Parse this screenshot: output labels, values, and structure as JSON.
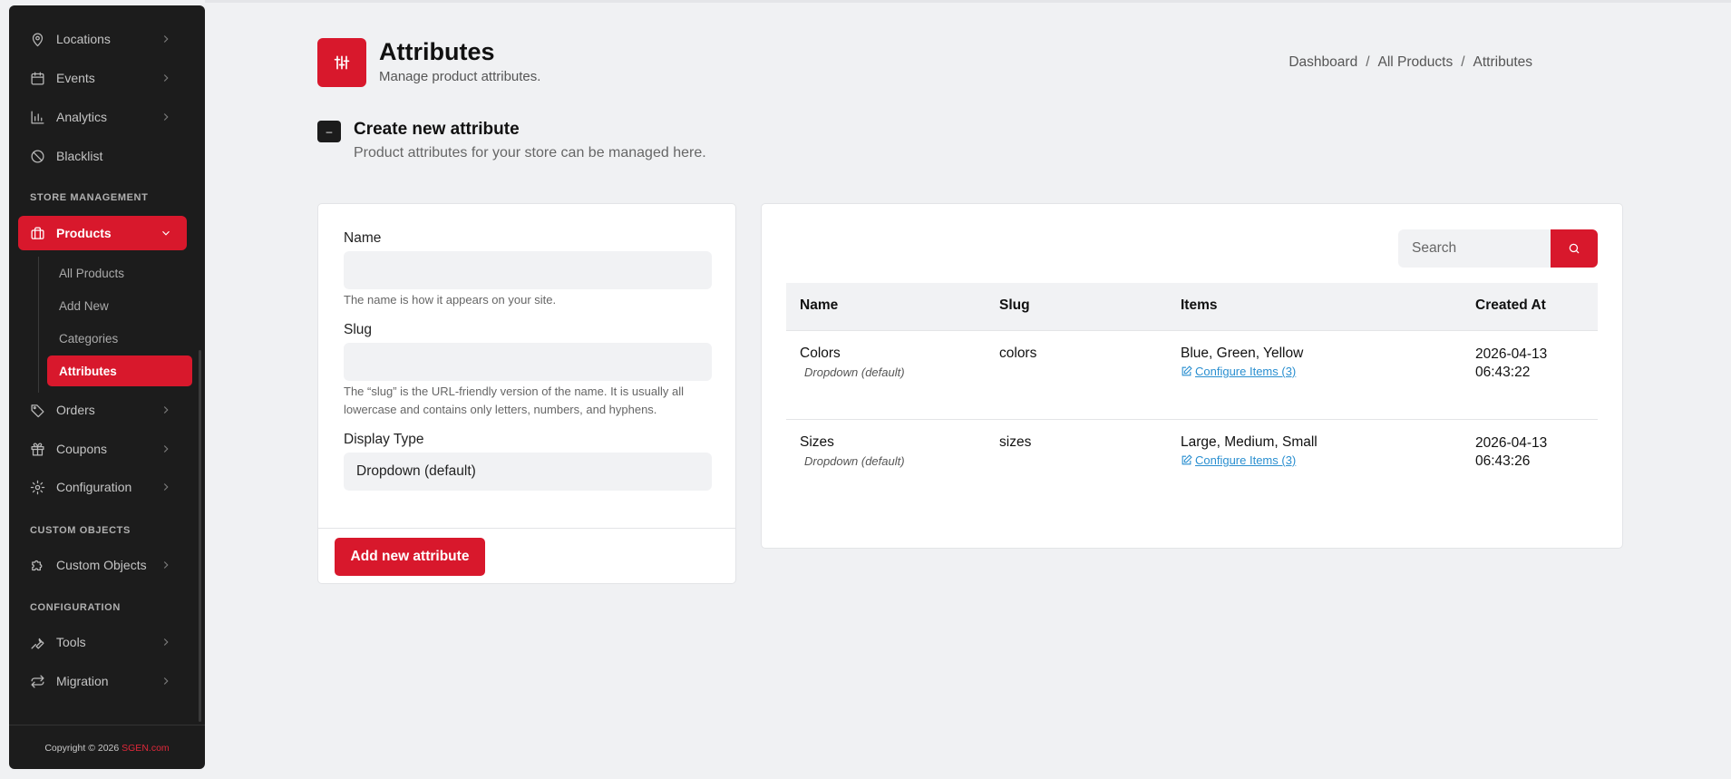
{
  "sidebar": {
    "items": [
      {
        "label": "Locations",
        "icon": "map-pin-icon"
      },
      {
        "label": "Events",
        "icon": "calendar-icon"
      },
      {
        "label": "Analytics",
        "icon": "bar-chart-icon"
      },
      {
        "label": "Blacklist",
        "icon": "ban-icon"
      }
    ],
    "store_section": "STORE MANAGEMENT",
    "products": {
      "label": "Products",
      "icon": "briefcase-icon"
    },
    "product_sub": [
      "All Products",
      "Add New",
      "Categories",
      "Attributes"
    ],
    "store_items": [
      {
        "label": "Orders",
        "icon": "tag-icon"
      },
      {
        "label": "Coupons",
        "icon": "gift-icon"
      },
      {
        "label": "Configuration",
        "icon": "gear-icon"
      }
    ],
    "custom_section": "CUSTOM OBJECTS",
    "custom_objects": {
      "label": "Custom Objects",
      "icon": "puzzle-icon"
    },
    "config_section": "CONFIGURATION",
    "config_items": [
      {
        "label": "Tools",
        "icon": "wrench-icon"
      },
      {
        "label": "Migration",
        "icon": "arrows-swap-icon"
      }
    ],
    "copyright_prefix": "Copyright © 2026 ",
    "copyright_brand": "SGEN.com"
  },
  "header": {
    "title": "Attributes",
    "subtitle": "Manage product attributes.",
    "breadcrumb": [
      "Dashboard",
      "All Products",
      "Attributes"
    ],
    "separator": "/"
  },
  "section": {
    "toggle": "–",
    "title": "Create new attribute",
    "description": "Product attributes for your store can be managed here."
  },
  "form": {
    "name_label": "Name",
    "name_value": "",
    "name_help": "The name is how it appears on your site.",
    "slug_label": "Slug",
    "slug_value": "",
    "slug_help": "The “slug” is the URL-friendly version of the name. It is usually all lowercase and contains only letters, numbers, and hyphens.",
    "display_type_label": "Display Type",
    "display_type_value": "Dropdown (default)",
    "submit_label": "Add new attribute"
  },
  "table": {
    "search_placeholder": "Search",
    "columns": [
      "Name",
      "Slug",
      "Items",
      "Created At"
    ],
    "rows": [
      {
        "name": "Colors",
        "type": "Dropdown (default)",
        "slug": "colors",
        "items": "Blue, Green, Yellow",
        "configure": "Configure Items (3)",
        "date": "2026-04-13",
        "time": "06:43:22"
      },
      {
        "name": "Sizes",
        "type": "Dropdown (default)",
        "slug": "sizes",
        "items": "Large, Medium, Small",
        "configure": "Configure Items (3)",
        "date": "2026-04-13",
        "time": "06:43:26"
      }
    ]
  },
  "colors": {
    "accent": "#d8182c",
    "sidebar_bg": "#1c1c1c",
    "page_bg": "#f0f1f3",
    "link": "#2a8fd0"
  }
}
